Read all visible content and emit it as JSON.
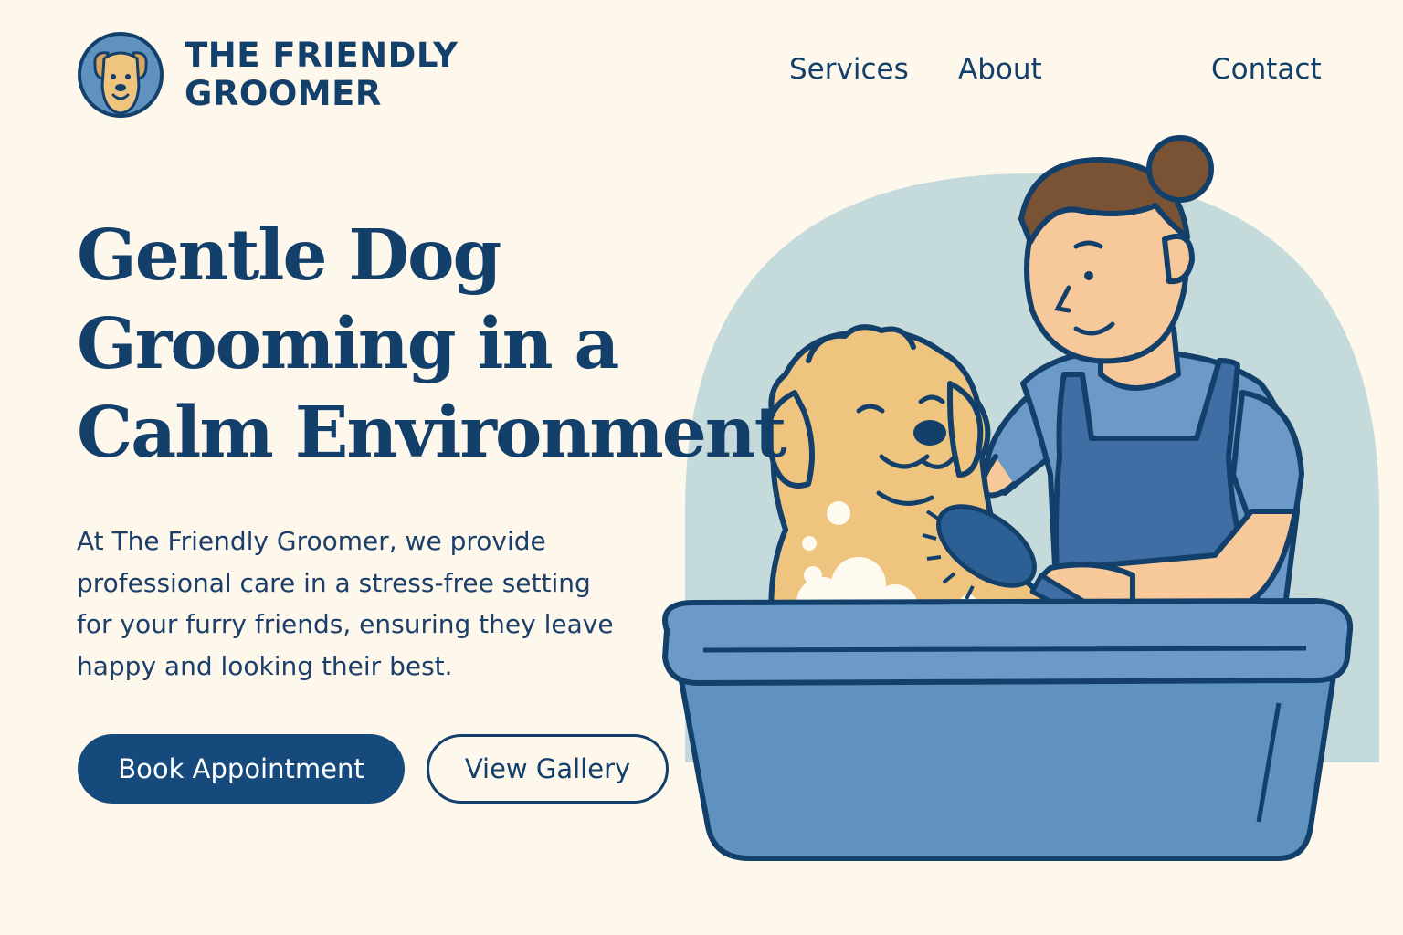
{
  "brand": {
    "name_line1": "THE FRIENDLY",
    "name_line2": "GROOMER",
    "logo_icon": "dog-face-logo-icon"
  },
  "nav": {
    "items": [
      {
        "label": "Services"
      },
      {
        "label": "About"
      },
      {
        "label": "Contact"
      }
    ]
  },
  "hero": {
    "title_lines": [
      "Gentle Dog",
      "Grooming in a",
      "Calm Environment"
    ],
    "description_lines": [
      "At The Friendly Groomer, we provide",
      "professional care in a stress-free setting",
      "for your furry friends, ensuring they leave",
      "happy and looking their best."
    ],
    "primary_button": "Book Appointment",
    "secondary_button": "View Gallery"
  },
  "illustration": {
    "subject": "groomer-bathing-dog-illustration"
  },
  "colors": {
    "background": "#fdf7ec",
    "navy": "#133f6b",
    "button_primary": "#174a7c",
    "arch": "#c5dadb",
    "tub": "#5f92bf",
    "dog": "#efc47e",
    "shirt": "#6b9ac8",
    "apron": "#3e6ea3",
    "hair": "#7a5234",
    "skin": "#f7c89a"
  }
}
